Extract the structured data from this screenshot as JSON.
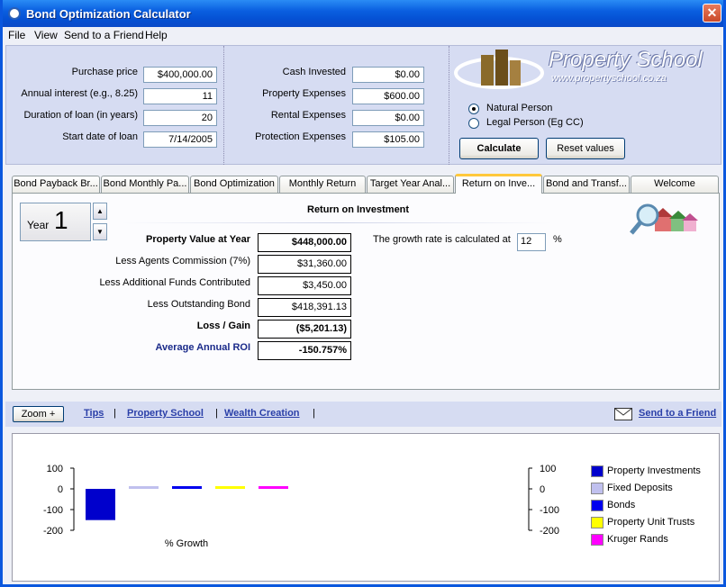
{
  "window": {
    "title": "Bond Optimization Calculator",
    "close_glyph": "✕"
  },
  "menu": [
    "File",
    "View",
    "Send to a Friend",
    "Help"
  ],
  "left_inputs": [
    {
      "label": "Purchase price",
      "value": "$400,000.00"
    },
    {
      "label": "Annual interest (e.g., 8.25)",
      "value": "11"
    },
    {
      "label": "Duration of loan (in years)",
      "value": "20"
    },
    {
      "label": "Start date of loan",
      "value": "7/14/2005"
    }
  ],
  "right_inputs": [
    {
      "label": "Cash Invested",
      "value": "$0.00"
    },
    {
      "label": "Property Expenses",
      "value": "$600.00"
    },
    {
      "label": "Rental Expenses",
      "value": "$0.00"
    },
    {
      "label": "Protection Expenses",
      "value": "$105.00"
    }
  ],
  "logo": {
    "name": "Property School",
    "url": "www.propertyschool.co.za"
  },
  "person_type": {
    "options": [
      "Natural Person",
      "Legal Person (Eg CC)"
    ],
    "selected": "Natural Person"
  },
  "buttons": {
    "calculate": "Calculate",
    "reset": "Reset values"
  },
  "tabs": [
    "Bond Payback Br...",
    "Bond Monthly Pa...",
    "Bond Optimization",
    "Monthly Return",
    "Target Year Anal...",
    "Return on Inve...",
    "Bond and Transf...",
    "Welcome"
  ],
  "active_tab": "Return on Inve...",
  "roi": {
    "title": "Return on Investment",
    "year_label": "Year",
    "year_value": "1",
    "growth_label": "The growth rate is calculated at",
    "growth_value": "12",
    "growth_unit": "%",
    "rows": [
      {
        "label": "Property Value at Year",
        "value": "$448,000.00",
        "bold": true
      },
      {
        "label": "Less Agents Commission (7%)",
        "value": "$31,360.00",
        "bold": false
      },
      {
        "label": "Less Additional Funds Contributed",
        "value": "$3,450.00",
        "bold": false
      },
      {
        "label": "Less Outstanding Bond",
        "value": "$418,391.13",
        "bold": false
      },
      {
        "label": "Loss / Gain",
        "value": "($5,201.13)",
        "bold": true
      },
      {
        "label": "Average Annual ROI",
        "value": "-150.757%",
        "bold": true,
        "color": "#1a2a8a"
      }
    ]
  },
  "bottom_bar": {
    "zoom": "Zoom +",
    "links": [
      "Tips",
      "Property School",
      "Wealth Creation"
    ],
    "send": "Send to a Friend"
  },
  "chart_data": {
    "type": "bar",
    "xlabel": "% Growth",
    "ylim": [
      -200,
      100
    ],
    "yticks": [
      100,
      0,
      -100,
      -200
    ],
    "legend_position": "right",
    "series": [
      {
        "name": "Property Investments",
        "value": -150.757,
        "color": "#0000cc"
      },
      {
        "name": "Fixed Deposits",
        "value": 10,
        "color": "#c0c0ee"
      },
      {
        "name": "Bonds",
        "value": 11,
        "color": "#0000ee"
      },
      {
        "name": "Property Unit Trusts",
        "value": 12,
        "color": "#ffff00"
      },
      {
        "name": "Kruger Rands",
        "value": 12,
        "color": "#ff00ff"
      }
    ]
  }
}
